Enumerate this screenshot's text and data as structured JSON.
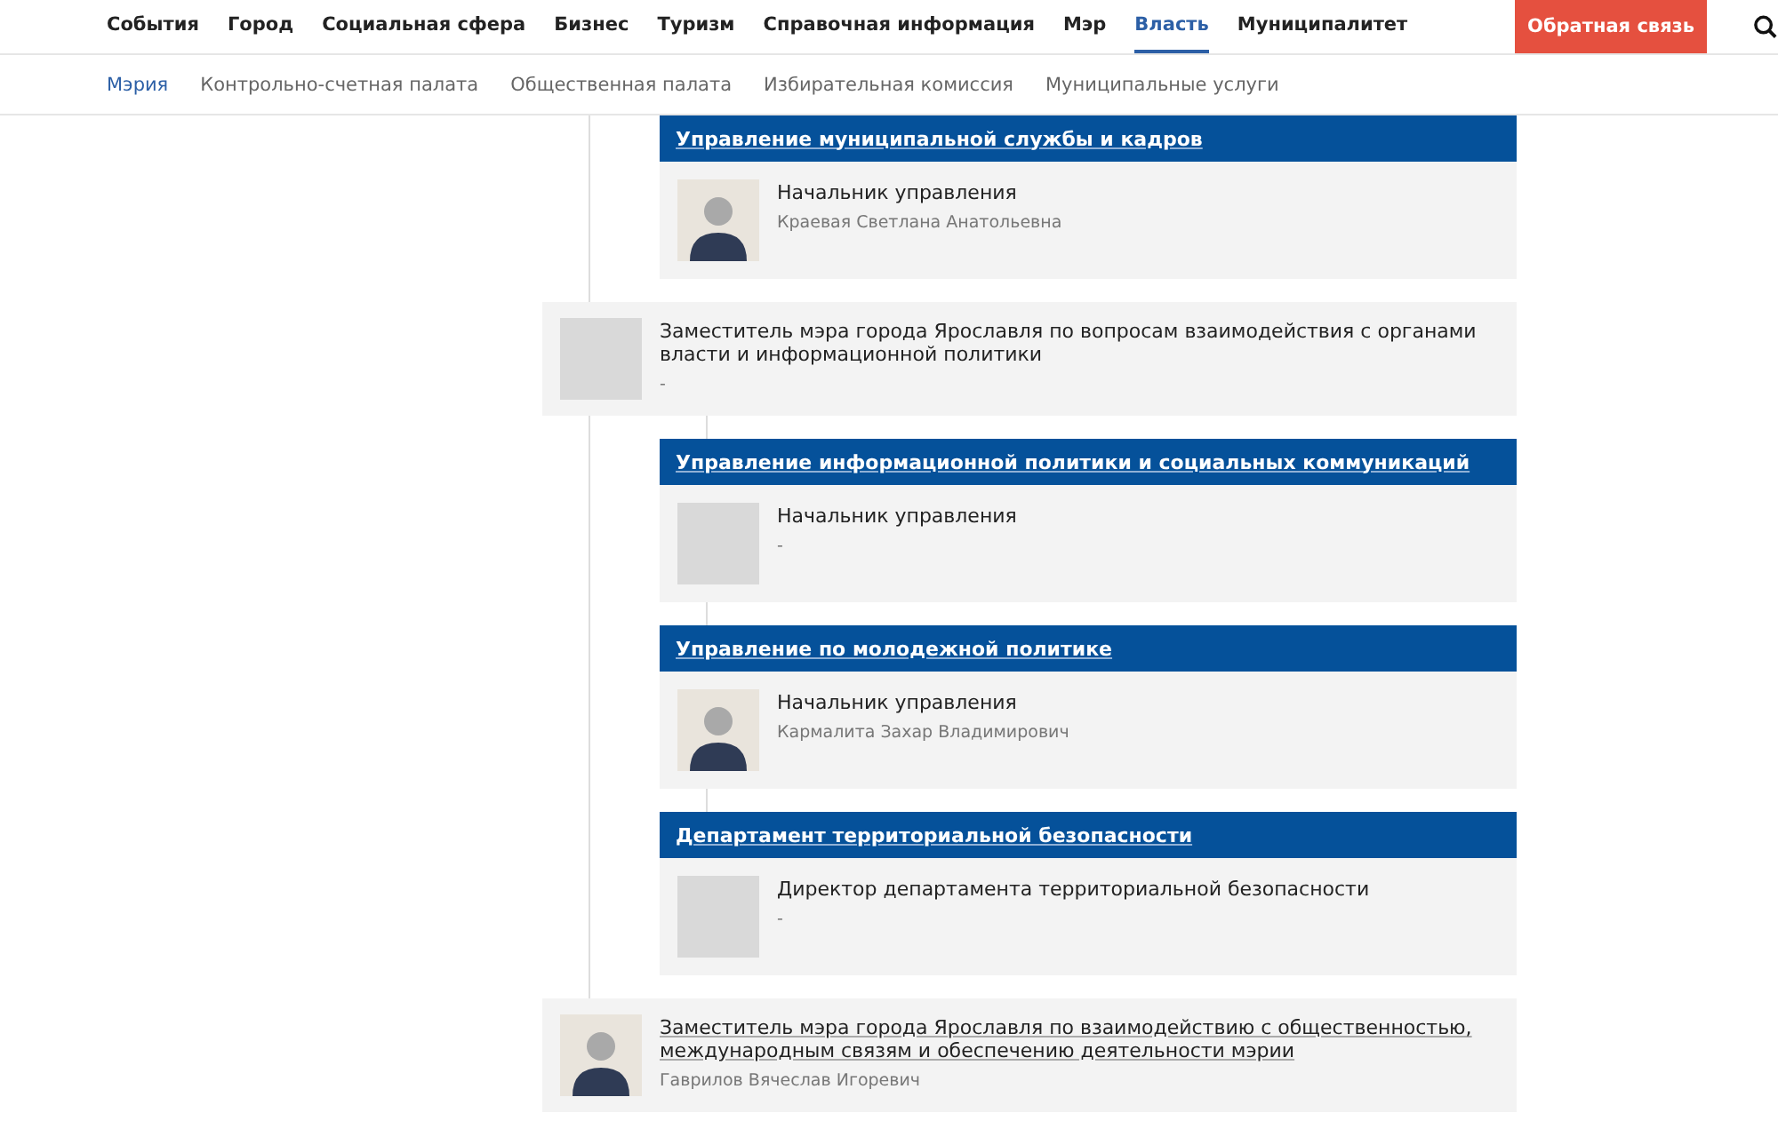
{
  "nav": {
    "items": [
      {
        "label": "События",
        "selected": false
      },
      {
        "label": "Город",
        "selected": false
      },
      {
        "label": "Социальная сфера",
        "selected": false
      },
      {
        "label": "Бизнес",
        "selected": false
      },
      {
        "label": "Туризм",
        "selected": false
      },
      {
        "label": "Справочная информация",
        "selected": false
      },
      {
        "label": "Мэр",
        "selected": false
      },
      {
        "label": "Власть",
        "selected": true
      },
      {
        "label": "Муниципалитет",
        "selected": false
      }
    ],
    "feedback_button": "Обратная связь"
  },
  "subnav": [
    {
      "label": "Мэрия",
      "selected": true
    },
    {
      "label": "Контрольно-счетная палата",
      "selected": false
    },
    {
      "label": "Общественная палата",
      "selected": false
    },
    {
      "label": "Избирательная комиссия",
      "selected": false
    },
    {
      "label": "Муниципальные услуги",
      "selected": false
    }
  ],
  "groups": [
    {
      "departments": [
        {
          "title": "Управление муниципальной службы и кадров",
          "role": "Начальник управления",
          "name": "Краевая Светлана Анатольевна",
          "photo": true
        }
      ]
    },
    {
      "deputy": {
        "title": "Заместитель мэра города Ярославля по вопросам взаимодействия с органами власти и информационной политики",
        "name": "-",
        "photo": false,
        "linked": false
      },
      "departments": [
        {
          "title": "Управление информационной политики и социальных коммуникаций",
          "role": "Начальник управления",
          "name": "-",
          "photo": false
        },
        {
          "title": "Управление по молодежной политике",
          "role": "Начальник управления",
          "name": "Кармалита Захар Владимирович",
          "photo": true
        },
        {
          "title": "Департамент территориальной безопасности",
          "role": "Директор департамента территориальной безопасности",
          "name": "-",
          "photo": false
        }
      ]
    },
    {
      "deputy": {
        "title": "Заместитель мэра города Ярославля по взаимодействию с общественностью, международным связям и обеспечению деятельности мэрии",
        "name": "Гаврилов Вячеслав Игоревич",
        "photo": true,
        "linked": true
      }
    }
  ]
}
